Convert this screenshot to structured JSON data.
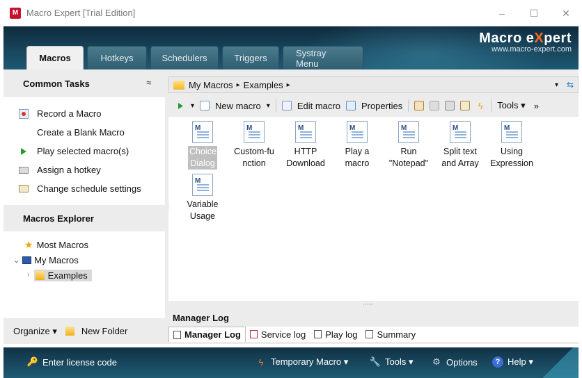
{
  "window": {
    "title": "Macro Expert [Trial Edition]",
    "minimize": "–",
    "maximize": "☐",
    "close": "✕",
    "app_icon_text": "M"
  },
  "brand": {
    "name_part1": "Macro e",
    "name_x": "X",
    "name_part2": "pert",
    "url": "www.macro-expert.com"
  },
  "tabs": [
    {
      "label": "Macros"
    },
    {
      "label": "Hotkeys"
    },
    {
      "label": "Schedulers"
    },
    {
      "label": "Triggers"
    },
    {
      "label": "Systray Menu"
    }
  ],
  "sidebar": {
    "common_tasks_title": "Common Tasks",
    "collapse_glyph": "≈",
    "tasks": [
      {
        "label": "Record a Macro"
      },
      {
        "label": "Create a Blank Macro"
      },
      {
        "label": "Play selected macro(s)"
      },
      {
        "label": "Assign a hotkey"
      },
      {
        "label": "Change schedule settings"
      }
    ],
    "explorer_title": "Macros Explorer",
    "tree": [
      {
        "label": "Most Macros"
      },
      {
        "label": "My Macros"
      },
      {
        "label": "Examples"
      }
    ],
    "organize_label": "Organize ▾",
    "new_folder_label": "New Folder"
  },
  "address": {
    "crumb1": "My Macros",
    "crumb2": "Examples",
    "sep": "▸",
    "dropdown": "▾"
  },
  "toolbar": {
    "new_macro": "New macro",
    "edit_macro": "Edit macro",
    "properties": "Properties",
    "tools": "Tools",
    "more": "»"
  },
  "macros": [
    {
      "label": "Choice Dialog",
      "selected": true
    },
    {
      "label": "Custom-function"
    },
    {
      "label": "HTTP Download"
    },
    {
      "label": "Play a macro"
    },
    {
      "label": "Run \"Notepad\""
    },
    {
      "label": "Split text and Array"
    },
    {
      "label": "Using Expression"
    },
    {
      "label": "Variable Usage"
    }
  ],
  "log": {
    "title": "Manager Log",
    "tabs": [
      {
        "label": "Manager Log"
      },
      {
        "label": "Service log"
      },
      {
        "label": "Play log"
      },
      {
        "label": "Summary"
      }
    ]
  },
  "bottom": {
    "license": "Enter license code",
    "temporary_macro": "Temporary Macro ▾",
    "tools": "Tools ▾",
    "options": "Options",
    "help": "Help ▾"
  },
  "colors": {
    "header_dark": "#0f2a3d",
    "brand_x": "#ff6a1a",
    "tab_inactive": "#3e6f82",
    "panel_bg": "#ececec"
  }
}
